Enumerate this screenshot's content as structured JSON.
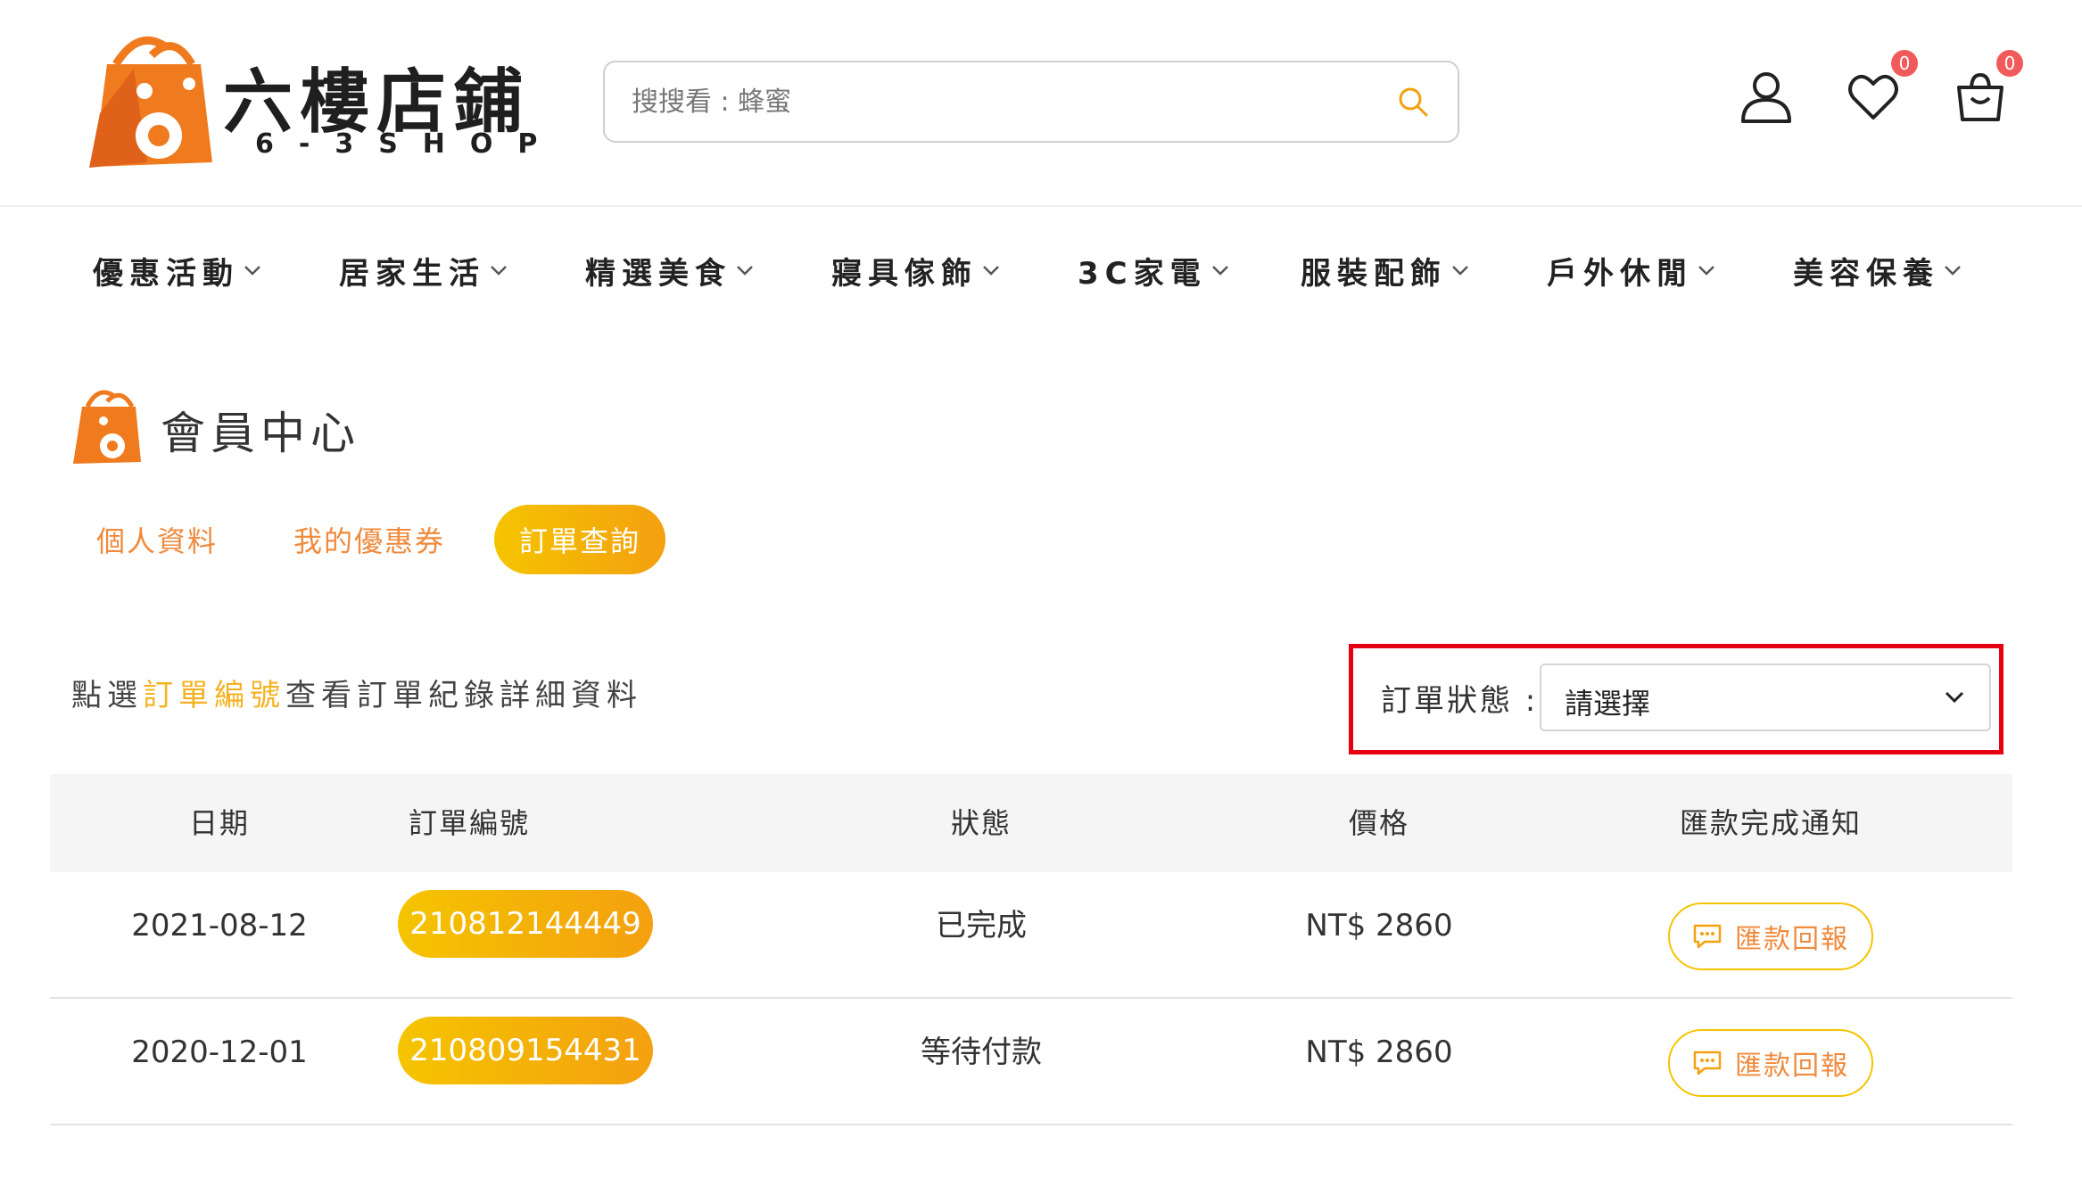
{
  "header": {
    "logo_text": "六樓店鋪",
    "logo_sub": "6-3SHOP",
    "search_placeholder": "搜搜看 : 蜂蜜",
    "wishlist_count": "0",
    "cart_count": "0"
  },
  "nav": [
    {
      "label": "優惠活動"
    },
    {
      "label": "居家生活"
    },
    {
      "label": "精選美食"
    },
    {
      "label": "寢具傢飾"
    },
    {
      "label": "3C家電"
    },
    {
      "label": "服裝配飾"
    },
    {
      "label": "戶外休閒"
    },
    {
      "label": "美容保養"
    }
  ],
  "member": {
    "title": "會員中心",
    "tabs": [
      {
        "label": "個人資料"
      },
      {
        "label": "我的優惠券"
      },
      {
        "label": "訂單查詢"
      }
    ]
  },
  "orders": {
    "hint_prefix": "點選",
    "hint_highlight": "訂單編號",
    "hint_suffix": "查看訂單紀錄詳細資料",
    "filter_label": "訂單狀態 :",
    "filter_value": "請選擇",
    "columns": [
      "日期",
      "訂單編號",
      "狀態",
      "價格",
      "匯款完成通知"
    ],
    "rows": [
      {
        "date": "2021-08-12",
        "order_no": "210812144449",
        "status": "已完成",
        "price": "NT$ 2860",
        "action": "匯款回報"
      },
      {
        "date": "2020-12-01",
        "order_no": "210809154431",
        "status": "等待付款",
        "price": "NT$ 2860",
        "action": "匯款回報"
      }
    ]
  },
  "colors": {
    "brand_orange": "#f07a1e",
    "accent_yellow": "#f5c400",
    "highlight_red": "#e60012"
  }
}
